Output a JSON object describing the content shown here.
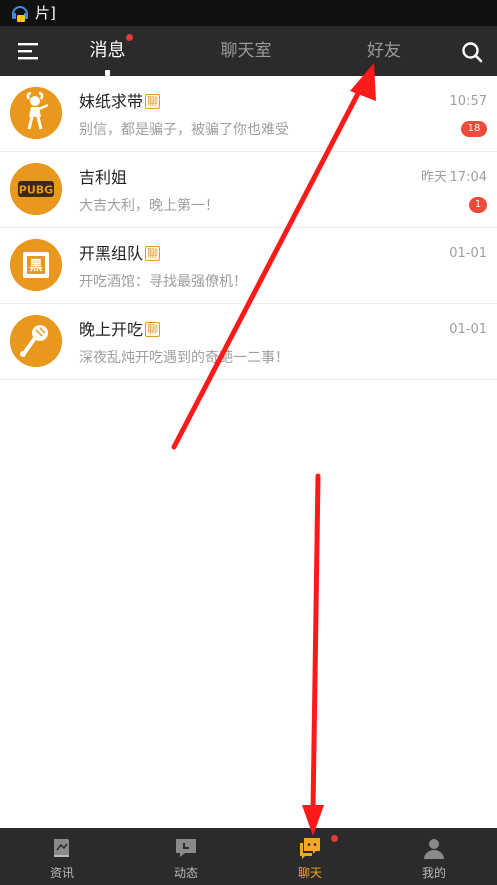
{
  "status_bar": {
    "text": "片]"
  },
  "header": {
    "tabs": [
      {
        "label": "消息",
        "active": true,
        "has_dot": true
      },
      {
        "label": "聊天室",
        "active": false
      },
      {
        "label": "好友",
        "active": false
      }
    ],
    "menu_icon": "menu-icon",
    "search_icon": "search-icon"
  },
  "chats": [
    {
      "name": "妹纸求带",
      "tag": "聊",
      "preview": "别信，都是骗子，被骗了你也难受",
      "time": "10:57",
      "badge": "18",
      "avatar_icon": "girl-avatar-icon"
    },
    {
      "name": "吉利姐",
      "tag": "",
      "preview": "大吉大利，晚上第一！",
      "date": "昨天",
      "time": "17:04",
      "badge": "1",
      "avatar_icon": "pubg-avatar-icon"
    },
    {
      "name": "开黑组队",
      "tag": "聊",
      "preview": "开吃酒馆：寻找最强僚机！",
      "time": "01-01",
      "avatar_icon": "team-avatar-icon"
    },
    {
      "name": "晚上开吃",
      "tag": "聊",
      "preview": "深夜乱炖开吃遇到的奇葩一二事！",
      "time": "01-01",
      "avatar_icon": "chicken-avatar-icon"
    }
  ],
  "bottom_nav": [
    {
      "label": "资讯",
      "icon": "news-icon",
      "active": false
    },
    {
      "label": "动态",
      "icon": "moments-icon",
      "active": false
    },
    {
      "label": "聊天",
      "icon": "chat-icon",
      "active": true,
      "has_dot": true
    },
    {
      "label": "我的",
      "icon": "profile-icon",
      "active": false
    }
  ],
  "colors": {
    "accent": "#f5a623",
    "avatar": "#e8981c",
    "badge": "#ef4a3a",
    "header": "#2b2b2b",
    "annotation_arrow": "#ff1a1a"
  }
}
